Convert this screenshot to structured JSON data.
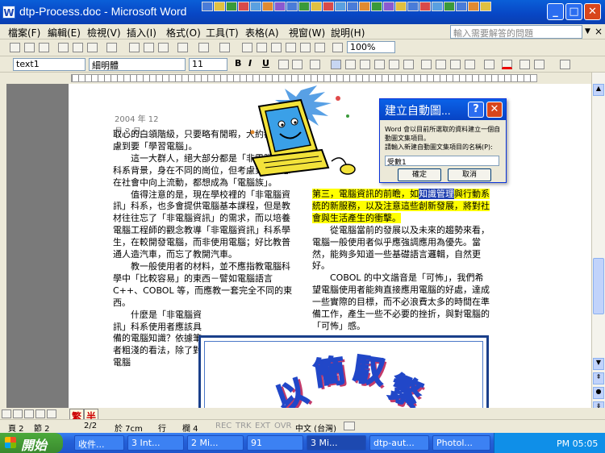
{
  "window": {
    "title": "dtp-Process.doc - Microsoft Word",
    "minimize": "_",
    "maximize": "□",
    "close": "✕"
  },
  "menu": {
    "items": [
      "檔案(F)",
      "編輯(E)",
      "檢視(V)",
      "插入(I)",
      "格式(O)",
      "工具(T)",
      "表格(A)",
      "視窗(W)",
      "說明(H)"
    ],
    "help_placeholder": "輸入需要解答的問題",
    "close": "×"
  },
  "toolbar": {
    "zoom": "100%",
    "style": "text1",
    "font": "細明體",
    "size": "11",
    "bold": "B",
    "italic": "I",
    "underline": "U"
  },
  "document": {
    "date": "2004 年 12 月 2 日",
    "left_column": [
      "取心的白領階級，只要略有閒暇，大約都會考慮到要「學習電腦」。",
      "　　這一大群人，絕大部分都是「非電腦資訊」科系背景，身在不同的崗位，但考慮到將來想在社會中向上流動，都想成為「電腦族」。",
      "　　值得注意的是，現在學校裡的「非電腦資訊」科系，也多會提供電腦基本課程，但是教材往往忘了「非電腦資訊」的需求，而以培養電腦工程師的觀念教導「非電腦資訊」科系學生，在較開發電腦，而非使用電腦；好比教普通人造汽車，而忘了教開汽車。",
      "　　教一般使用者的材料，並不應指教電腦科學中「比較容易」的東西－譬如電腦語言 C++、COBOL 等，而應教一套完全不同的東西。",
      "　　什麼是「非電腦資訊」科系使用者應該具備的電腦知識？依據筆者粗淺的看法，除了對電腦"
    ],
    "right_column": {
      "hl1": "第三，電腦資訊的前瞻，如",
      "selected": "知識管理",
      "hl2": "與行動系統的新服務，以及注意這些創新發展，將對社會與生活產生的衝擊。",
      "p2": "　　從電腦當前的發展以及未來的趨勢來看，電腦一般使用者似乎應強調應用為優先。當然，能夠多知道一些基礎語言邏輯，自然更好。",
      "p3": "　　COBOL 的中文諧音是「可怖」，我們希望電腦使用者能夠直接應用電腦的好處，達成一些實際的目標，而不必浪費太多的時間在準備工作，產生一些不必要的挫折，與對電腦的「可怖」感。"
    },
    "wordart": [
      "以",
      "簡",
      "馭",
      "繁"
    ]
  },
  "dialog": {
    "title": "建立自動圖...",
    "help": "?",
    "close": "✕",
    "message": "Word 會以目前所選取的資料建立一個自動圖文集項目。",
    "prompt": "請輸入新建自動圖文集項目的名稱(P):",
    "input_value": "受數1",
    "ok": "確定",
    "cancel": "取消"
  },
  "ime": {
    "a": "繁",
    "b": "半"
  },
  "status": {
    "page": "頁 2",
    "section": "節 2",
    "pages": "2/2",
    "position": "於 7cm",
    "line": "行",
    "column": "欄 4",
    "rec": "REC",
    "trk": "TRK",
    "ext": "EXT",
    "ovr": "OVR",
    "language": "中文 (台灣)"
  },
  "taskbar": {
    "start": "開始",
    "buttons": [
      "收件...",
      "3 Int...",
      "2 Mi...",
      "91",
      "3 Mi...",
      "dtp-aut...",
      "Photol..."
    ],
    "clock": "PM 05:05"
  }
}
